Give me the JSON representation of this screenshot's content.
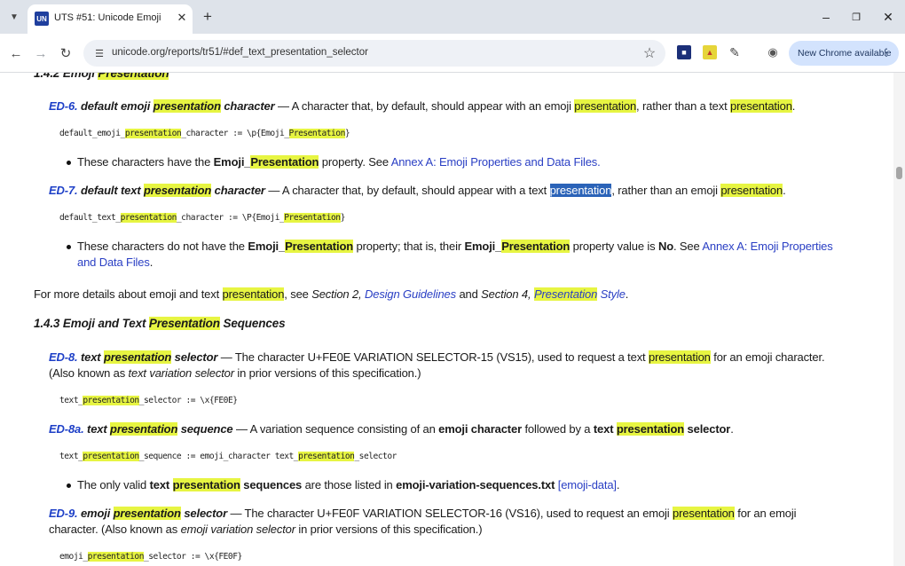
{
  "browser": {
    "tab_title": "UTS #51: Unicode Emoji",
    "tab_favicon_text": "UN",
    "url": "unicode.org/reports/tr51/#def_text_presentation_selector",
    "update_button": "New Chrome available",
    "icons": [
      "tab-search-icon",
      "close-icon",
      "plus-icon",
      "minimize-icon",
      "restore-icon",
      "back-icon",
      "forward-icon",
      "reload-icon",
      "site-info-icon",
      "star-icon",
      "extension-icon",
      "puzzle-icon",
      "profile-icon",
      "more-icon"
    ]
  },
  "doc": {
    "top_cut": {
      "a": "1.4.2 Emoji ",
      "b": "Presentation"
    },
    "ed6": {
      "id": "ED-6.",
      "t1": "default emoji",
      "t2": "presentation",
      "t3": "character",
      "d1": "— A character that, by default, should appear with an emoji",
      "d2": "presentation",
      "d3": ", rather than a text",
      "d4": "presentation",
      "d5": ".",
      "code": {
        "a": "default_emoji_",
        "b": "presentation",
        "c": "_character := \\p{Emoji_",
        "d": "Presentation",
        "e": "}"
      },
      "bullet": {
        "a": "These characters have the",
        "b": "Emoji_",
        "c": "Presentation",
        "d": "property. See",
        "link": "Annex A: Emoji Properties and Data Files",
        "e": "."
      }
    },
    "ed7": {
      "id": "ED-7.",
      "t1": "default text",
      "t2": "presentation",
      "t3": "character",
      "d1": "— A character that, by default, should appear with a text",
      "d2": "presentation",
      "d3": ", rather than an emoji",
      "d4": "presentation",
      "d5": ".",
      "code": {
        "a": "default_text_",
        "b": "presentation",
        "c": "_character := \\P{Emoji_",
        "d": "Presentation",
        "e": "}"
      },
      "bullet": {
        "a": "These characters do not have the",
        "b": "Emoji_",
        "c": "Presentation",
        "d": "property; that is, their",
        "e": "Emoji_",
        "f": "Presentation",
        "g": "property value is",
        "h": "No",
        "i": ". See",
        "link1": "Annex A: Emoji Properties",
        "link2": "and Data Files",
        "j": "."
      }
    },
    "more": {
      "a": "For more details about emoji and text",
      "b": "presentation",
      "c": ", see",
      "d": "Section 2,",
      "e": "Design Guidelines",
      "f": "and",
      "g": "Section 4,",
      "h": "Presentation",
      "k": "Style",
      "l": "."
    },
    "h143": {
      "a": "1.4.3 Emoji and Text",
      "b": "Presentation",
      "c": "Sequences"
    },
    "ed8": {
      "id": "ED-8.",
      "t1": "text",
      "t2": "presentation",
      "t3": "selector",
      "d1": "— The character U+FE0E VARIATION SELECTOR-15 (VS15), used to request a text",
      "d2": "presentation",
      "d3": "for an emoji character.",
      "l2a": "(Also known as",
      "l2b": "text variation selector",
      "l2c": "in prior versions of this specification.)",
      "code": {
        "a": "text_",
        "b": "presentation",
        "c": "_selector := \\x{FE0E}"
      }
    },
    "ed8a": {
      "id": "ED-8a.",
      "t1": "text",
      "t2": "presentation",
      "t3": "sequence",
      "d1": "— A variation sequence consisting of an",
      "d2": "emoji character",
      "d3": "followed by a",
      "d4": "text",
      "d5": "presentation",
      "d6": "selector",
      "d7": ".",
      "code": {
        "a": "text_",
        "b": "presentation",
        "c": "_sequence := emoji_character text_",
        "d": "presentation",
        "e": "_selector"
      },
      "bullet": {
        "a": "The only valid",
        "b": "text",
        "c": "presentation",
        "d": "sequences",
        "e": "are those listed in",
        "f": "emoji-variation-sequences.txt",
        "link": "[emoji-data]",
        "g": "."
      }
    },
    "ed9": {
      "id": "ED-9.",
      "t1": "emoji",
      "t2": "presentation",
      "t3": "selector",
      "d1": "— The character U+FE0F VARIATION SELECTOR-16 (VS16), used to request an emoji",
      "d2": "presentation",
      "d3": "for an emoji",
      "l2a": "character. (Also known as",
      "l2b": "emoji variation selector",
      "l2c": "in prior versions of this specification.)",
      "code": {
        "a": "emoji_",
        "b": "presentation",
        "c": "_selector := \\x{FE0F}"
      }
    }
  }
}
